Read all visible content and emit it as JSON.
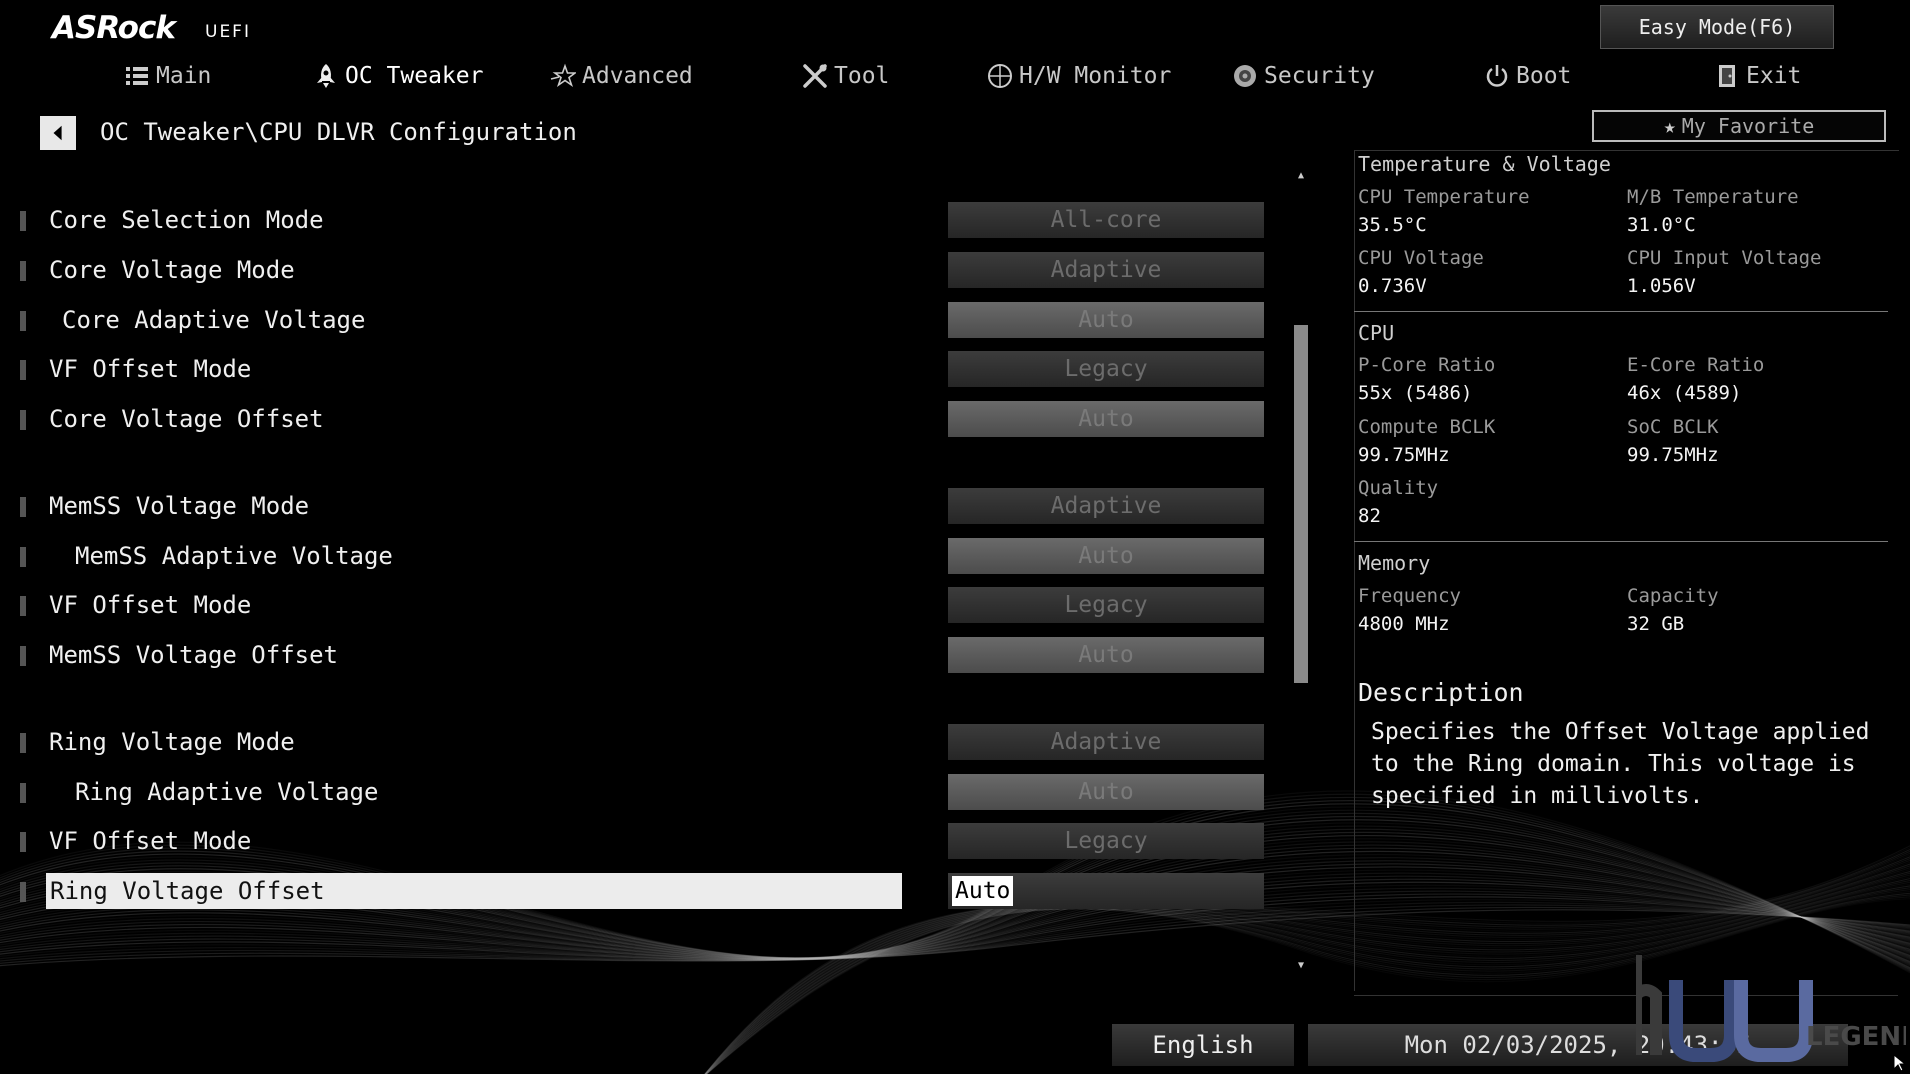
{
  "header": {
    "brand": "ASRock",
    "uefi_label": "UEFI",
    "easy_mode": "Easy Mode(F6)",
    "my_favorite": "My Favorite"
  },
  "tabs": [
    {
      "label": "Main",
      "icon": "list-icon",
      "active": false
    },
    {
      "label": "OC Tweaker",
      "icon": "rocket-icon",
      "active": true
    },
    {
      "label": "Advanced",
      "icon": "star-icon",
      "active": false
    },
    {
      "label": "Tool",
      "icon": "tools-icon",
      "active": false
    },
    {
      "label": "H/W Monitor",
      "icon": "monitor-icon",
      "active": false
    },
    {
      "label": "Security",
      "icon": "shield-icon",
      "active": false
    },
    {
      "label": "Boot",
      "icon": "power-icon",
      "active": false
    },
    {
      "label": "Exit",
      "icon": "exit-door-icon",
      "active": false
    }
  ],
  "breadcrumb": "OC Tweaker\\CPU DLVR Configuration",
  "settings": [
    {
      "label": "Core Selection Mode",
      "value": "All-core"
    },
    {
      "label": "Core Voltage Mode",
      "value": "Adaptive"
    },
    {
      "label": "Core Adaptive Voltage",
      "value": "Auto"
    },
    {
      "label": "VF Offset Mode",
      "value": "Legacy"
    },
    {
      "label": "Core Voltage Offset",
      "value": "Auto"
    },
    {
      "label": "MemSS Voltage Mode",
      "value": "Adaptive"
    },
    {
      "label": "MemSS Adaptive Voltage",
      "value": "Auto"
    },
    {
      "label": "VF Offset Mode",
      "value": "Legacy"
    },
    {
      "label": "MemSS Voltage Offset",
      "value": "Auto"
    },
    {
      "label": "Ring Voltage Mode",
      "value": "Adaptive"
    },
    {
      "label": "Ring Adaptive Voltage",
      "value": "Auto"
    },
    {
      "label": "VF Offset Mode",
      "value": "Legacy"
    },
    {
      "label": "Ring Voltage Offset",
      "value": "Auto"
    }
  ],
  "selected_setting": "Ring Voltage Offset",
  "info": {
    "temp_voltage": {
      "title": "Temperature & Voltage",
      "cpu_temp_label": "CPU Temperature",
      "cpu_temp": "35.5°C",
      "mb_temp_label": "M/B Temperature",
      "mb_temp": "31.0°C",
      "cpu_voltage_label": "CPU Voltage",
      "cpu_voltage": "0.736V",
      "cpu_input_voltage_label": "CPU Input Voltage",
      "cpu_input_voltage": "1.056V"
    },
    "cpu": {
      "title": "CPU",
      "pcore_label": "P-Core Ratio",
      "pcore": "55x (5486)",
      "ecore_label": "E-Core Ratio",
      "ecore": "46x (4589)",
      "compute_bclk_label": "Compute BCLK",
      "compute_bclk": "99.75MHz",
      "soc_bclk_label": "SoC BCLK",
      "soc_bclk": "99.75MHz",
      "quality_label": "Quality",
      "quality": "82"
    },
    "memory": {
      "title": "Memory",
      "frequency_label": "Frequency",
      "frequency": "4800 MHz",
      "capacity_label": "Capacity",
      "capacity": "32 GB"
    }
  },
  "description": {
    "title": "Description",
    "text": "Specifies the Offset Voltage applied to the Ring domain. This voltage is specified in millivolts."
  },
  "footer": {
    "language": "English",
    "datetime": "Mon 02/03/2025, 20:43:55"
  },
  "watermark": "LEGEND"
}
